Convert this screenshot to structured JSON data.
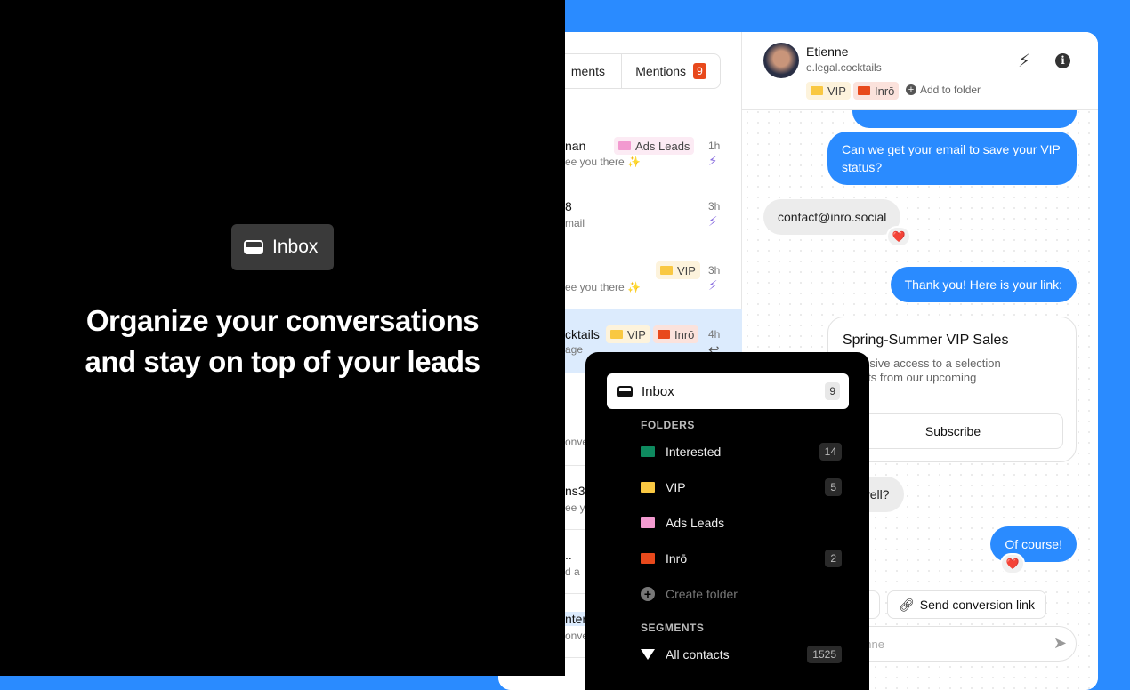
{
  "promo": {
    "pill_label": "Inbox",
    "headline_line1": "Organize your conversations",
    "headline_line2": "and stay on top of your leads"
  },
  "tabs": {
    "comments_partial": "ments",
    "mentions": "Mentions",
    "mentions_count": "9"
  },
  "conversations": [
    {
      "name": "nan",
      "preview": "ee you there ✨",
      "time": "1h",
      "tags": [
        "Ads Leads"
      ]
    },
    {
      "name": "8",
      "preview": "mail",
      "time": "3h",
      "tags": []
    },
    {
      "name": "",
      "preview": "ee you there ✨",
      "time": "3h",
      "tags": [
        "VIP"
      ]
    },
    {
      "name": "cktails",
      "preview": "age",
      "time": "4h",
      "tags": [
        "VIP",
        "Inrō"
      ]
    },
    {
      "name": "",
      "preview": "onve"
    },
    {
      "name": "ns3",
      "preview": "ee y"
    },
    {
      "name": "..",
      "preview": "d a"
    },
    {
      "name": "nter",
      "preview": "onve"
    }
  ],
  "contact": {
    "name": "Etienne",
    "handle": "e.legal.cocktails",
    "tags": [
      "VIP",
      "Inrō"
    ],
    "add_folder": "Add to folder"
  },
  "messages": {
    "m1": "Can we get your email to save your VIP status?",
    "m2": "contact@inro.social",
    "m3": "Thank you! Here is your link:",
    "card_title": "Spring-Summer VIP Sales",
    "card_body_l1": "exclusive access to a selection",
    "card_body_l2": "oducts from our upcoming",
    "card_body_l3": "ction!",
    "card_button": "Subscribe",
    "m4": "friend as well?",
    "m5": "Of course!",
    "reaction": "❤️",
    "quick_reply": "Send conversion link",
    "composer_placeholder": "enne"
  },
  "menu": {
    "inbox": "Inbox",
    "inbox_count": "9",
    "folders_header": "FOLDERS",
    "folders": [
      {
        "label": "Interested",
        "count": "14",
        "color": "#0e8a5f"
      },
      {
        "label": "VIP",
        "count": "5",
        "color": "#f9c842"
      },
      {
        "label": "Ads Leads",
        "count": "",
        "color": "#f29ad0"
      },
      {
        "label": "Inrō",
        "count": "2",
        "color": "#e8491c"
      }
    ],
    "create_folder": "Create folder",
    "segments_header": "SEGMENTS",
    "all_contacts": "All contacts",
    "all_contacts_count": "1525"
  },
  "colors": {
    "accent": "#2a8bff",
    "vip": "#f9c842",
    "inro": "#e8491c",
    "ads": "#f29ad0",
    "interested": "#0e8a5f",
    "bolt": "#8a6fe0"
  }
}
